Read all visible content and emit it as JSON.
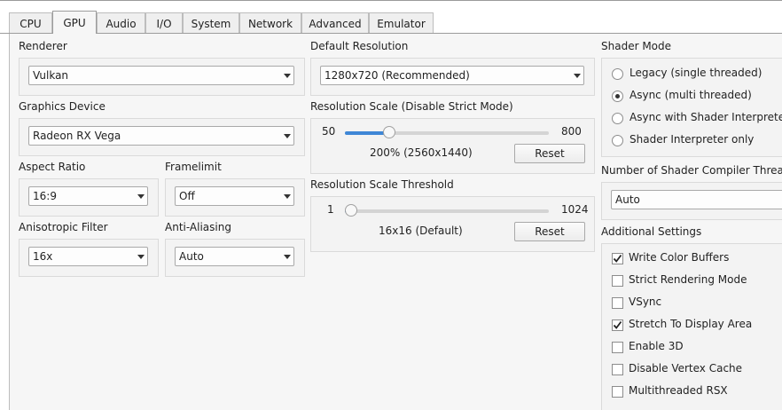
{
  "tabs": [
    "CPU",
    "GPU",
    "Audio",
    "I/O",
    "System",
    "Network",
    "Advanced",
    "Emulator"
  ],
  "active_tab": "GPU",
  "renderer": {
    "label": "Renderer",
    "value": "Vulkan"
  },
  "graphics_device": {
    "label": "Graphics Device",
    "value": "Radeon RX Vega"
  },
  "aspect_ratio": {
    "label": "Aspect Ratio",
    "value": "16:9"
  },
  "framelimit": {
    "label": "Framelimit",
    "value": "Off"
  },
  "anisotropic_filter": {
    "label": "Anisotropic Filter",
    "value": "16x"
  },
  "anti_aliasing": {
    "label": "Anti-Aliasing",
    "value": "Auto"
  },
  "default_resolution": {
    "label": "Default Resolution",
    "value": "1280x720 (Recommended)"
  },
  "resolution_scale": {
    "label": "Resolution Scale (Disable Strict Mode)",
    "min": "50",
    "max": "800",
    "value_text": "200% (2560x1440)",
    "level": 0.2,
    "reset": "Reset"
  },
  "resolution_scale_threshold": {
    "label": "Resolution Scale Threshold",
    "min": "1",
    "max": "1024",
    "value_text": "16x16 (Default)",
    "level": 0.0,
    "reset": "Reset"
  },
  "shader_mode": {
    "label": "Shader Mode",
    "options": [
      {
        "label": "Legacy (single threaded)",
        "selected": false
      },
      {
        "label": "Async (multi threaded)",
        "selected": true
      },
      {
        "label": "Async with Shader Interpreter",
        "selected": false
      },
      {
        "label": "Shader Interpreter only",
        "selected": false
      }
    ]
  },
  "shader_compiler_threads": {
    "label": "Number of Shader Compiler Threads",
    "value": "Auto"
  },
  "additional_settings": {
    "label": "Additional Settings",
    "items": [
      {
        "label": "Write Color Buffers",
        "checked": true
      },
      {
        "label": "Strict Rendering Mode",
        "checked": false
      },
      {
        "label": "VSync",
        "checked": false
      },
      {
        "label": "Stretch To Display Area",
        "checked": true
      },
      {
        "label": "Enable 3D",
        "checked": false
      },
      {
        "label": "Disable Vertex Cache",
        "checked": false
      },
      {
        "label": "Multithreaded RSX",
        "checked": false
      }
    ]
  },
  "colors": {
    "accent": "#3f87d6",
    "panel": "#f6f6f6",
    "groupbox": "#f3f3f3"
  }
}
